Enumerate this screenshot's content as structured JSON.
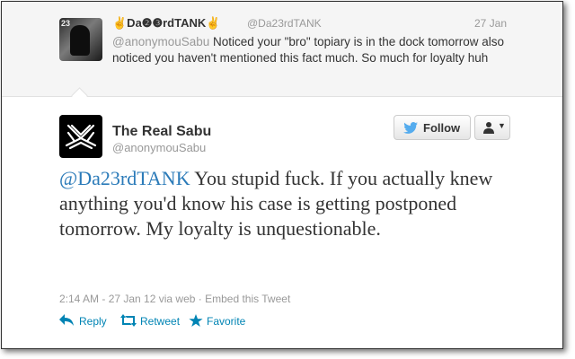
{
  "parent_tweet": {
    "display_name": "✌Da❷❸rdTANK✌",
    "handle": "@Da23rdTANK",
    "date": "27 Jan",
    "mention": "@anonymouSabu",
    "text": " Noticed your \"bro\" topiary is in the dock tomorrow also noticed you haven't mentioned this fact much. So much for loyalty huh",
    "avatar_text": "23"
  },
  "tweet": {
    "display_name": "The Real Sabu",
    "handle": "@anonymouSabu",
    "mention": "@Da23rdTANK",
    "text": " You stupid fuck. If you actually knew anything you'd know his case is getting postponed tomorrow. My loyalty is unquestionable.",
    "time": "2:14 AM - 27 Jan 12 via web",
    "separator": " · ",
    "embed": "Embed this Tweet"
  },
  "buttons": {
    "follow": "Follow"
  },
  "actions": {
    "reply": "Reply",
    "retweet": "Retweet",
    "favorite": "Favorite"
  },
  "colors": {
    "link": "#2b7bb9",
    "action": "#0084b4",
    "twitter_bird": "#55acee"
  },
  "icons": [
    "twitter-bird-icon",
    "user-icon",
    "caret-down-icon",
    "reply-icon",
    "retweet-icon",
    "star-icon"
  ]
}
